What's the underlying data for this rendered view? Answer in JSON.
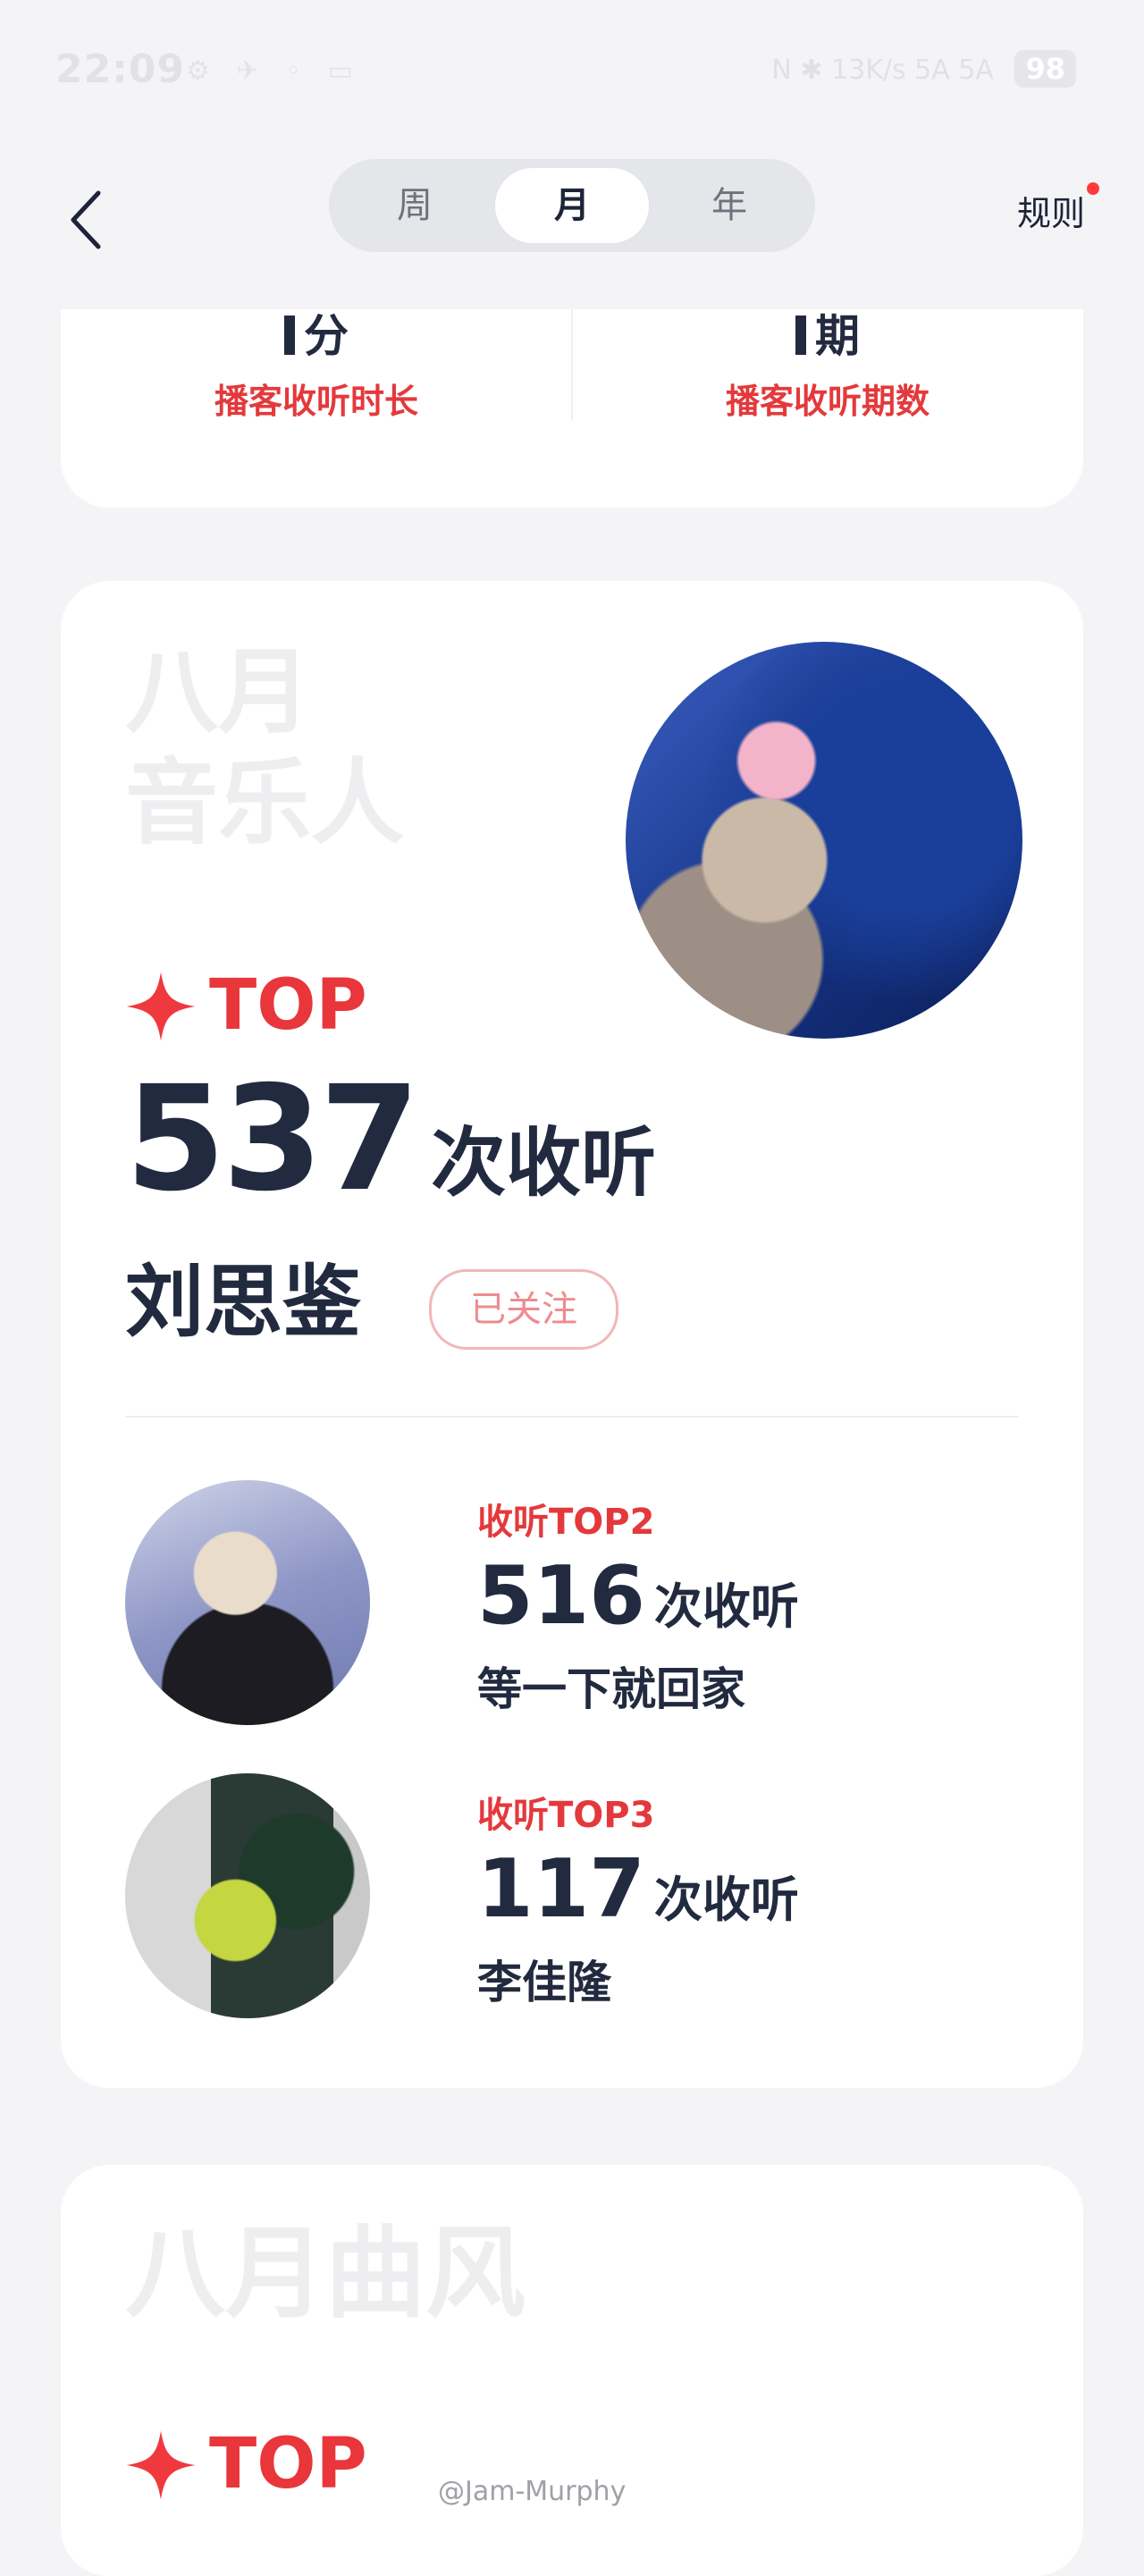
{
  "status_bar": {
    "time": "22:09",
    "left_icons": "⚙ ✈ ◦ ▭",
    "right_icons": "N ✱ 13K/s 5A 5A",
    "battery": "98"
  },
  "nav": {
    "tabs": [
      {
        "label": "周",
        "selected": false
      },
      {
        "label": "月",
        "selected": true
      },
      {
        "label": "年",
        "selected": false
      }
    ],
    "rules_label": "规则"
  },
  "podcast": {
    "duration_value": "分",
    "duration_label": "播客收听时长",
    "episodes_value": "期",
    "episodes_label": "播客收听期数"
  },
  "musician": {
    "title_line1": "八月",
    "title_line2": "音乐人",
    "top_label": "TOP",
    "top_count": "537",
    "unit": "次收听",
    "top_artist": "刘思鉴",
    "follow_label": "已关注",
    "others": [
      {
        "rank": "收听TOP2",
        "count": "516",
        "unit": "次收听",
        "name": "等一下就回家"
      },
      {
        "rank": "收听TOP3",
        "count": "117",
        "unit": "次收听",
        "name": "李佳隆"
      }
    ]
  },
  "genre": {
    "title": "八月曲风",
    "top_label": "TOP"
  },
  "watermark": "@Jam-Murphy",
  "colors": {
    "accent": "#e8363a",
    "text_dark": "#222a3f",
    "background": "#f4f4f7"
  }
}
